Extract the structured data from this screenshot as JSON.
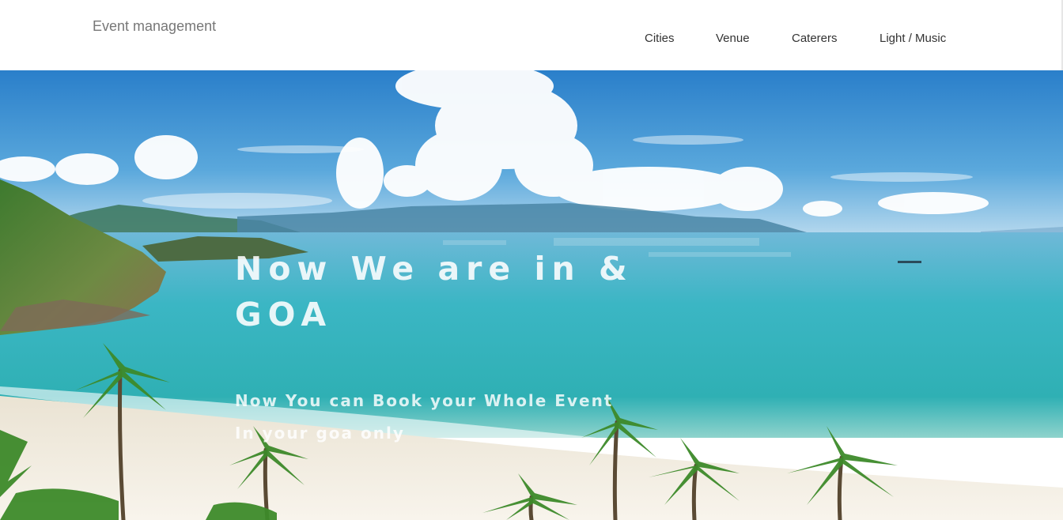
{
  "brand": {
    "title": "Event management"
  },
  "nav": {
    "items": [
      "Cities",
      "Venue",
      "Caterers",
      "Light / Music"
    ]
  },
  "hero": {
    "headline_line1": "Now We are in &",
    "headline_line2": "GOA",
    "subline1": "Now You can Book your Whole Event",
    "subline2": "In your goa only",
    "background": "tropical-beach-photo"
  },
  "colors": {
    "header_bg": "#ffffff",
    "brand_text": "#777777",
    "nav_text": "#333333",
    "sky_top": "#2f86cf",
    "sea": "#2bb3c0",
    "sand": "#f4efe6"
  }
}
